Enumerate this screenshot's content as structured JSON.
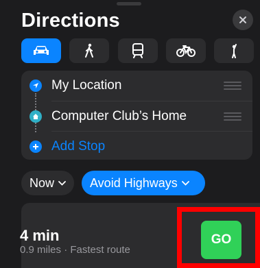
{
  "header": {
    "title": "Directions",
    "close_icon": "close-icon"
  },
  "transport_modes": [
    {
      "name": "drive",
      "icon": "car-icon",
      "selected": true
    },
    {
      "name": "walk",
      "icon": "walking-icon",
      "selected": false
    },
    {
      "name": "transit",
      "icon": "train-icon",
      "selected": false
    },
    {
      "name": "cycle",
      "icon": "bicycle-icon",
      "selected": false
    },
    {
      "name": "ride-share",
      "icon": "hailing-person-icon",
      "selected": false
    }
  ],
  "route": {
    "stops": [
      {
        "label": "My Location",
        "icon": "location-arrow-icon"
      },
      {
        "label": "Computer Club’s Home",
        "icon": "home-icon"
      }
    ],
    "add_stop_label": "Add Stop"
  },
  "options": {
    "time_label": "Now",
    "avoid_label": "Avoid Highways"
  },
  "result": {
    "eta": "4 min",
    "details": "0.9 miles · Fastest route",
    "go_label": "GO"
  },
  "colors": {
    "background": "#1c1c1e",
    "card": "#2c2c2e",
    "accent": "#0a84ff",
    "go": "#30d158",
    "highlight": "#ff0000"
  }
}
